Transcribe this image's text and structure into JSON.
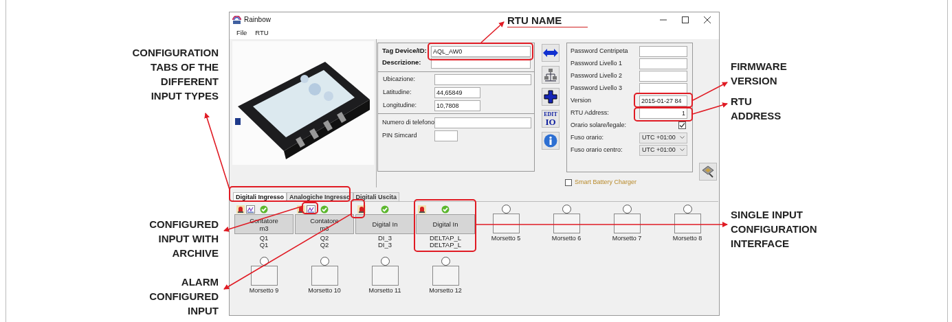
{
  "annotations": {
    "top": {
      "lines": [
        "RTU NAME"
      ]
    },
    "left": [
      {
        "lines": [
          "CONFIGURATION",
          "TABS OF THE",
          "DIFFERENT",
          "INPUT TYPES"
        ]
      },
      {
        "lines": [
          "CONFIGURED",
          "INPUT WITH",
          "ARCHIVE"
        ]
      },
      {
        "lines": [
          "ALARM",
          "CONFIGURED",
          "INPUT"
        ]
      }
    ],
    "right": [
      {
        "lines": [
          "FIRMWARE",
          "VERSION"
        ]
      },
      {
        "lines": [
          "RTU",
          "ADDRESS"
        ]
      },
      {
        "lines": [
          "SINGLE INPUT",
          "CONFIGURATION",
          "INTERFACE"
        ]
      }
    ]
  },
  "window": {
    "title": "Rainbow",
    "menu": [
      "File",
      "RTU"
    ]
  },
  "device": {
    "fields": [
      {
        "label": "Tag Device/ID:",
        "value": "AQL_AW0"
      },
      {
        "label": "Descrizione:"
      }
    ],
    "location": [
      {
        "label": "Ubicazione:",
        "kind": "wide"
      },
      {
        "label": "Latitudine:",
        "value": "44,65849",
        "kind": "short"
      },
      {
        "label": "Longitudine:",
        "value": "10,7808",
        "kind": "short"
      }
    ],
    "contact": [
      {
        "label": "Numero di telefono",
        "kind": "wide"
      },
      {
        "label": "PIN Simcard",
        "kind": "tiny"
      }
    ]
  },
  "tool_buttons": [
    {
      "kind": "transfer"
    },
    {
      "kind": "network"
    },
    {
      "kind": "add"
    },
    {
      "kind": "edit_io",
      "lines": [
        "EDIT",
        "IO"
      ]
    },
    {
      "kind": "info"
    }
  ],
  "settings": [
    {
      "kind": "field",
      "label": "Password Centripeta"
    },
    {
      "kind": "field",
      "label": "Password Livello 1"
    },
    {
      "kind": "field",
      "label": "Password Livello 2"
    },
    {
      "kind": "field",
      "label": "Password Livello 3"
    },
    {
      "kind": "field",
      "label": "Version",
      "value": "2015-01-27 84"
    },
    {
      "kind": "field",
      "label": "RTU Address:",
      "value": "1"
    },
    {
      "kind": "checkbox",
      "label": "Orario solare/legale:",
      "checked": true
    },
    {
      "kind": "select",
      "label": "Fuso orario:",
      "value": "UTC +01:00"
    },
    {
      "kind": "select",
      "label": "Fuso orario centro:",
      "value": "UTC +01:00"
    }
  ],
  "smart_battery_charger": {
    "label": "Smart Battery Charger",
    "checked": false
  },
  "tabs": [
    {
      "label": "Digitali Ingresso",
      "selected": true
    },
    {
      "label": "Analogiche Ingresso",
      "selected": false
    },
    {
      "label": "Digitali Uscita",
      "selected": false
    }
  ],
  "terminals": [
    {
      "kind": "configured",
      "name": "Contatore",
      "unit": "m3",
      "tags": [
        "Q1",
        "Q1"
      ],
      "alarm": true,
      "archive": true
    },
    {
      "kind": "configured",
      "name": "Contatore",
      "unit": "m3",
      "tags": [
        "Q2",
        "Q2"
      ],
      "alarm": true,
      "archive": true
    },
    {
      "kind": "configured",
      "name": "Digital In",
      "tags": [
        "DI_3",
        "DI_3"
      ],
      "alarm": true,
      "archive": false
    },
    {
      "kind": "configured",
      "name": "Digital In",
      "tags": [
        "DELTAP_L",
        "DELTAP_L"
      ],
      "alarm": true,
      "archive": false
    },
    {
      "kind": "empty",
      "label": "Morsetto 5"
    },
    {
      "kind": "empty",
      "label": "Morsetto 6"
    },
    {
      "kind": "empty",
      "label": "Morsetto 7"
    },
    {
      "kind": "empty",
      "label": "Morsetto 8"
    },
    {
      "kind": "empty",
      "label": "Morsetto 9"
    },
    {
      "kind": "empty",
      "label": "Morsetto 10"
    },
    {
      "kind": "empty",
      "label": "Morsetto 11"
    },
    {
      "kind": "empty",
      "label": "Morsetto 12"
    }
  ]
}
